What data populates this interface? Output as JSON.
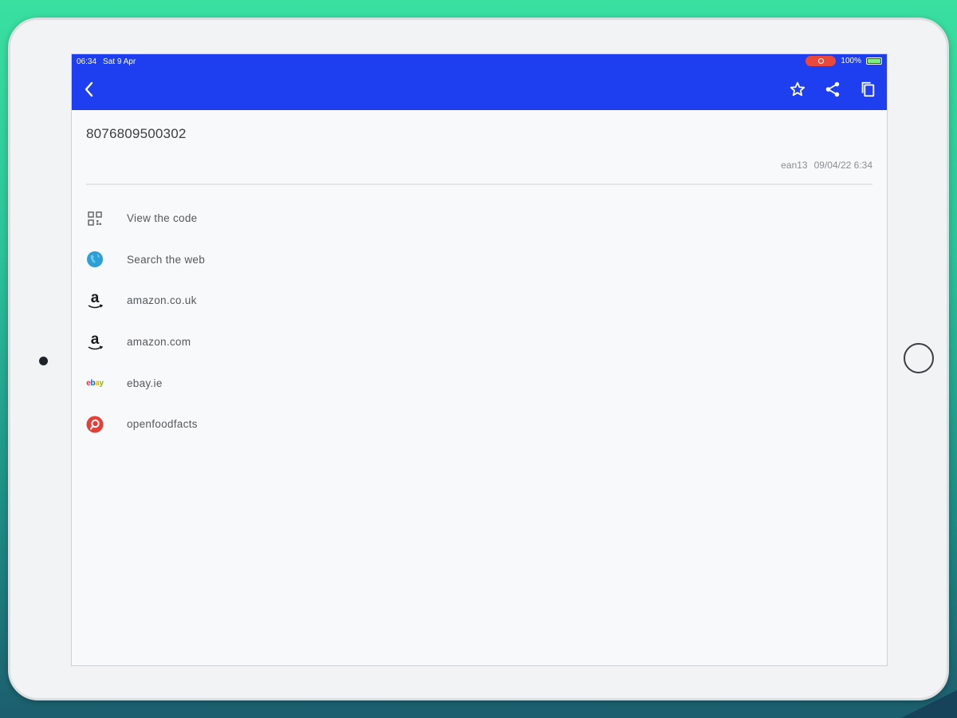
{
  "status_bar": {
    "time": "06:34",
    "date": "Sat 9 Apr",
    "battery_percent": "100%",
    "battery_level": 1.0
  },
  "app_bar": {
    "icons": [
      "back-icon",
      "star-icon",
      "share-icon",
      "copy-icon"
    ],
    "color": "#1d3ff0"
  },
  "barcode": {
    "value": "8076809500302",
    "format": "ean13",
    "timestamp": "09/04/22 6:34"
  },
  "actions": [
    {
      "label": "View the code",
      "icon": "qr-code-icon"
    },
    {
      "label": "Search the web",
      "icon": "globe-icon"
    },
    {
      "label": "amazon.co.uk",
      "icon": "amazon-icon"
    },
    {
      "label": "amazon.com",
      "icon": "amazon-icon"
    },
    {
      "label": "ebay.ie",
      "icon": "ebay-icon",
      "icon_text": "ebay"
    },
    {
      "label": "openfoodfacts",
      "icon": "openfoodfacts-icon"
    }
  ],
  "colors": {
    "accent": "#1d3ff0",
    "globe": "#2e9fd6",
    "openfoodfacts": "#e3403a",
    "ebay": "#5aa53b",
    "background_top": "#39e0a0",
    "background_bottom": "#1c5e6e"
  }
}
